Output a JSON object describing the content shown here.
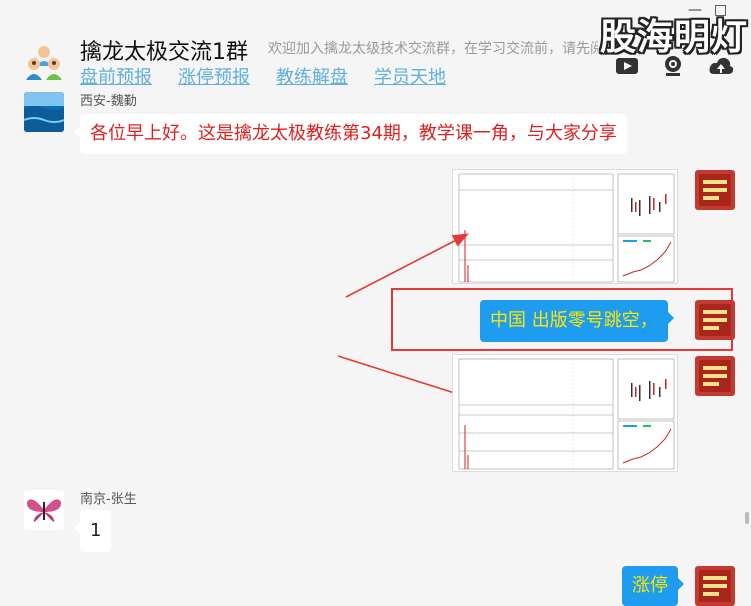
{
  "window": {
    "minimize": "—",
    "maximize": "□",
    "watermark": "股海明灯"
  },
  "header": {
    "title": "擒龙太极交流1群",
    "description": "欢迎加入擒龙太级技术交流群，在学习交流前，请先阅读",
    "nav": [
      "盘前预报",
      "涨停预报",
      "教练解盘",
      "学员天地"
    ],
    "icons": [
      "video-icon",
      "live-camera-icon",
      "upload-icon"
    ]
  },
  "messages": [
    {
      "sender": "西安-魏勤",
      "text": "各位早上好。这是擒龙太极教练第34期，教学课一角，与大家分享",
      "text_color": "#e02020"
    },
    {
      "type": "image",
      "side": "right",
      "description_icon": "stock-chart-screenshot"
    },
    {
      "side": "right",
      "text": "中国  出版零号跳空，"
    },
    {
      "type": "image",
      "side": "right",
      "description_icon": "stock-chart-screenshot"
    },
    {
      "sender": "南京-张生",
      "text": "1"
    },
    {
      "side": "right",
      "text": "涨停"
    }
  ],
  "colors": {
    "accent": "#1e9cf0",
    "annotation_red": "#e53935",
    "nav_link": "#5fb0dc",
    "bubble_text_right": "#ffe600"
  }
}
